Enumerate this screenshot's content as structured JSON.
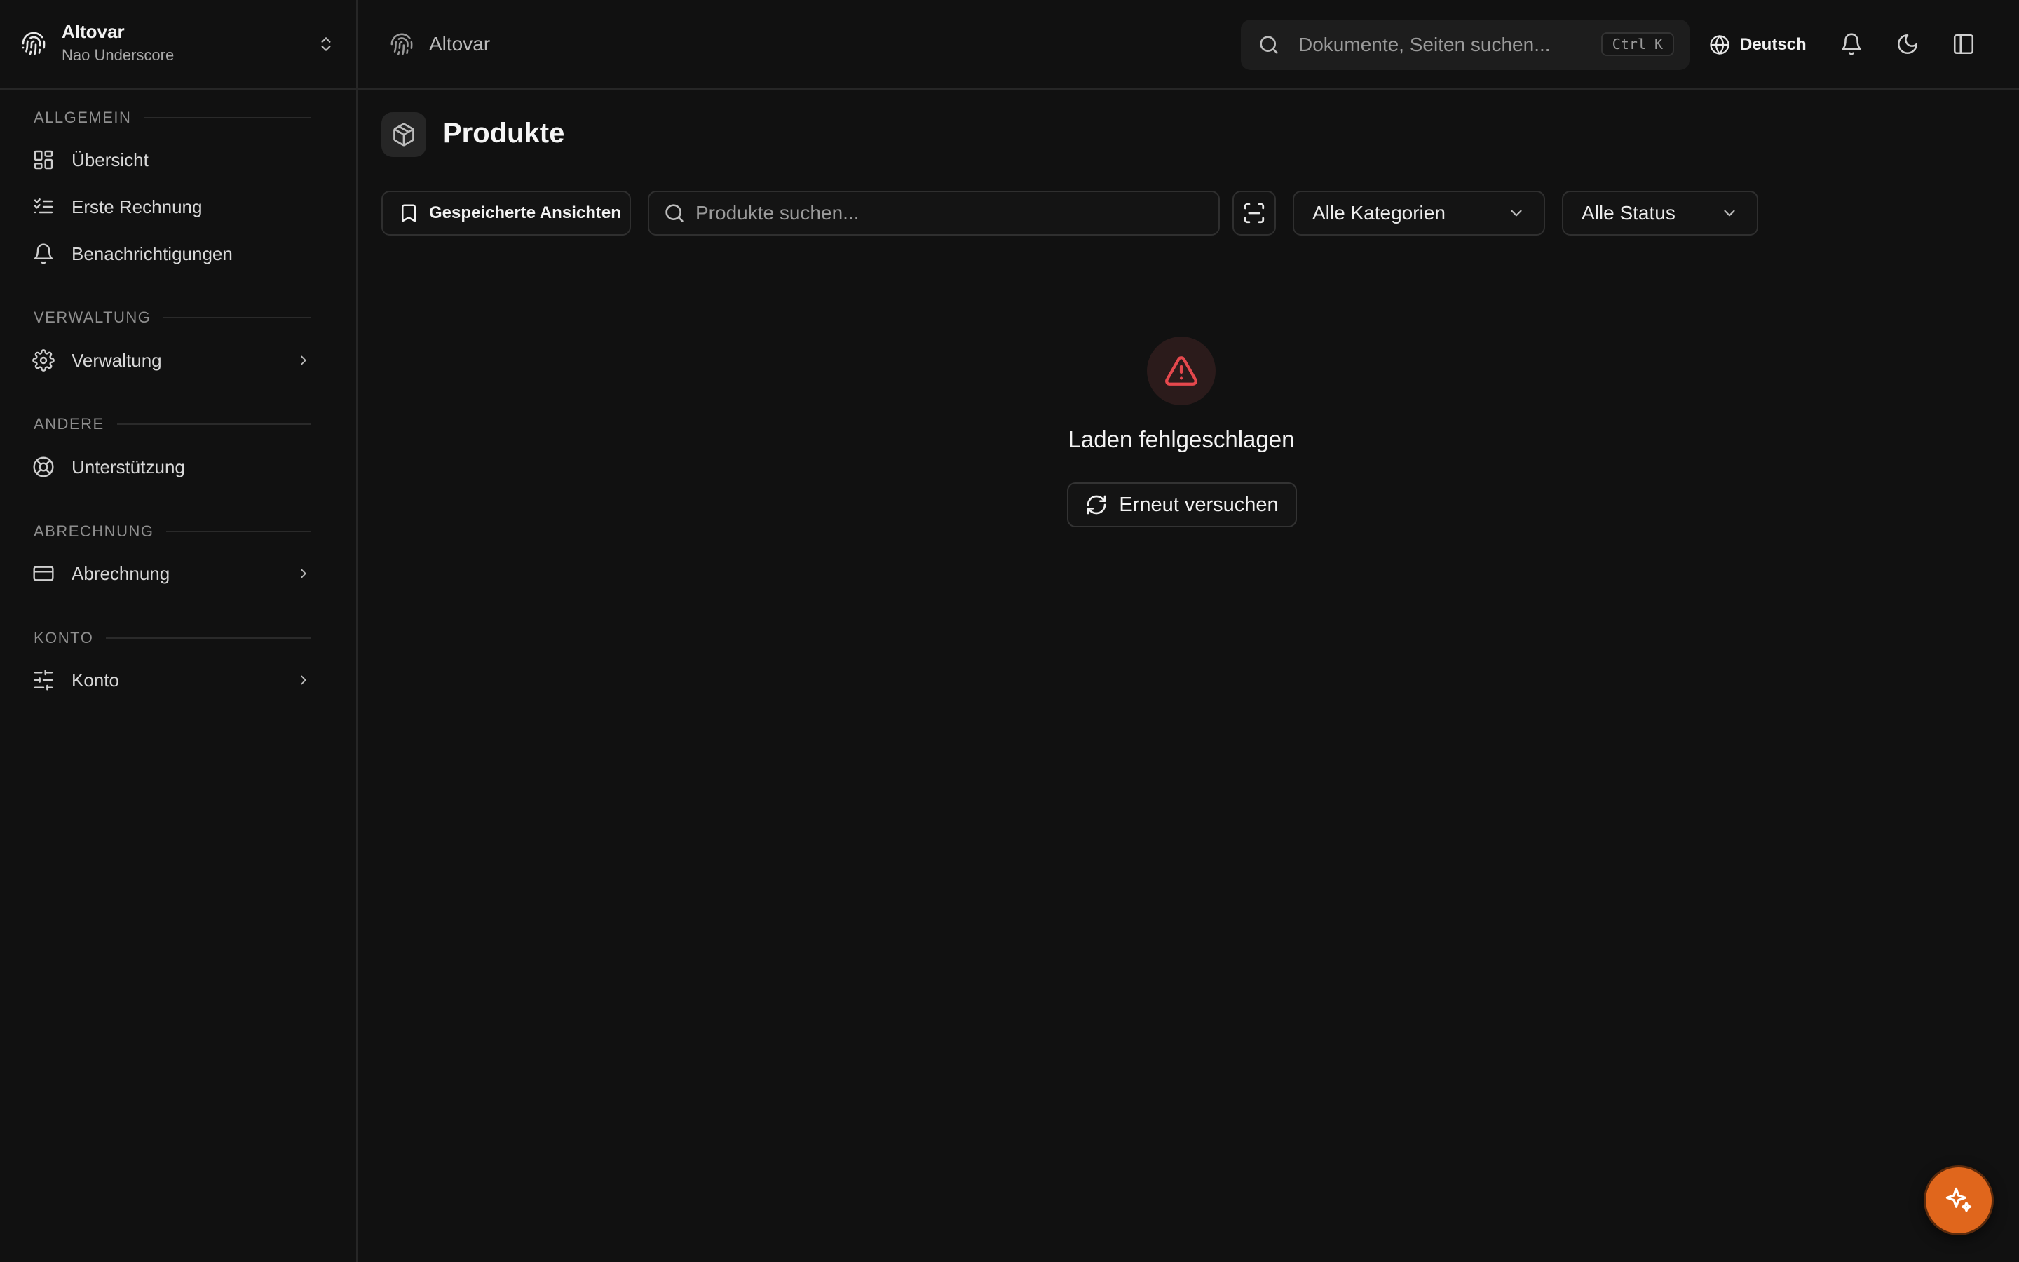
{
  "workspace": {
    "name": "Altovar",
    "subtitle": "Nao Underscore"
  },
  "sidebar": {
    "sections": [
      {
        "title": "ALLGEMEIN"
      },
      {
        "title": "VERWALTUNG"
      },
      {
        "title": "ANDERE"
      },
      {
        "title": "ABRECHNUNG"
      },
      {
        "title": "KONTO"
      }
    ],
    "items": [
      {
        "label": "Übersicht",
        "icon": "dashboard-icon"
      },
      {
        "label": "Erste Rechnung",
        "icon": "checklist-icon"
      },
      {
        "label": "Benachrichtigungen",
        "icon": "bell-icon"
      },
      {
        "label": "Verwaltung",
        "icon": "gear-icon"
      },
      {
        "label": "Unterstützung",
        "icon": "lifebuoy-icon"
      },
      {
        "label": "Abrechnung",
        "icon": "credit-card-icon"
      },
      {
        "label": "Konto",
        "icon": "sliders-icon"
      }
    ]
  },
  "header": {
    "breadcrumb": "Altovar",
    "search_placeholder": "Dokumente, Seiten suchen...",
    "shortcut": "Ctrl K",
    "language": "Deutsch"
  },
  "page": {
    "title": "Produkte",
    "saved_views_label": "Gespeicherte Ansichten",
    "search_placeholder": "Produkte suchen...",
    "category_filter": "Alle Kategorien",
    "status_filter": "Alle Status"
  },
  "error": {
    "title": "Laden fehlgeschlagen",
    "retry_label": "Erneut versuchen"
  },
  "colors": {
    "background": "#111111",
    "accent": "#e0661c",
    "error": "#e5484d",
    "border": "#262626"
  }
}
